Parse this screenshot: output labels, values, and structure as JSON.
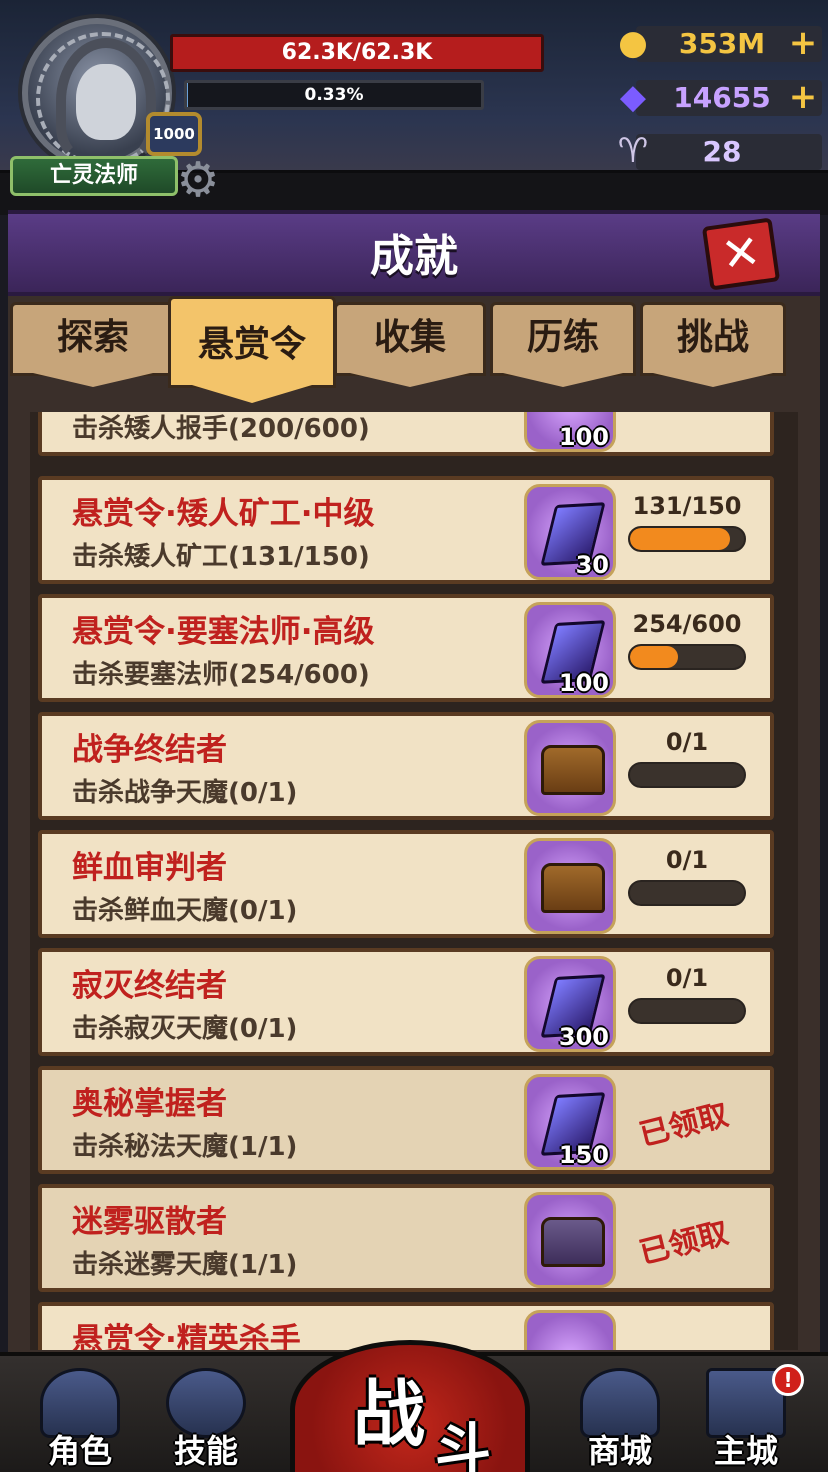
{
  "player": {
    "class_name": "亡灵法师",
    "level": "1000",
    "hp_text": "62.3K/62.3K",
    "exp_text": "0.33%",
    "exp_fraction": 0.0033
  },
  "resources": {
    "gold": "353M",
    "gems": "14655",
    "horns": "28",
    "plus": "+"
  },
  "panel": {
    "title": "成就",
    "close_icon": "close-icon"
  },
  "tabs": [
    {
      "label": "探索"
    },
    {
      "label": "悬赏令",
      "active": true
    },
    {
      "label": "收集"
    },
    {
      "label": "历练"
    },
    {
      "label": "挑战"
    }
  ],
  "list": {
    "partial_top": {
      "desc": "击杀矮人报手(200/600)",
      "reward_count": "100"
    },
    "items": [
      {
        "title": "悬赏令·矮人矿工·中级",
        "desc": "击杀矮人矿工(131/150)",
        "reward_type": "gem",
        "reward_count": "30",
        "progress_text": "131/150",
        "progress": 0.873,
        "claimed": false
      },
      {
        "title": "悬赏令·要塞法师·高级",
        "desc": "击杀要塞法师(254/600)",
        "reward_type": "gem",
        "reward_count": "100",
        "progress_text": "254/600",
        "progress": 0.423,
        "claimed": false
      },
      {
        "title": "战争终结者",
        "desc": "击杀战争天魔(0/1)",
        "reward_type": "chest",
        "reward_count": "",
        "progress_text": "0/1",
        "progress": 0,
        "claimed": false
      },
      {
        "title": "鲜血审判者",
        "desc": "击杀鲜血天魔(0/1)",
        "reward_type": "chest",
        "reward_count": "",
        "progress_text": "0/1",
        "progress": 0,
        "claimed": false
      },
      {
        "title": "寂灭终结者",
        "desc": "击杀寂灭天魔(0/1)",
        "reward_type": "gem",
        "reward_count": "300",
        "progress_text": "0/1",
        "progress": 0,
        "claimed": false
      },
      {
        "title": "奥秘掌握者",
        "desc": "击杀秘法天魔(1/1)",
        "reward_type": "gem",
        "reward_count": "150",
        "claimed": true,
        "claimed_text": "已领取"
      },
      {
        "title": "迷雾驱散者",
        "desc": "击杀迷雾天魔(1/1)",
        "reward_type": "open-chest",
        "reward_count": "",
        "claimed": true,
        "claimed_text": "已领取"
      }
    ],
    "partial_bottom": {
      "title": "悬赏令·精英杀手"
    }
  },
  "nav": {
    "role": "角色",
    "skills": "技能",
    "battle_1": "战",
    "battle_2": "斗",
    "shop": "商城",
    "main_city": "主城",
    "alert": "!"
  },
  "colors": {
    "hp_red": "#b51d1d",
    "title_red": "#c0211e",
    "progress_orange": "#f28a1e",
    "tab_active": "#f3c46a",
    "header_purple": "#5a3c86"
  }
}
